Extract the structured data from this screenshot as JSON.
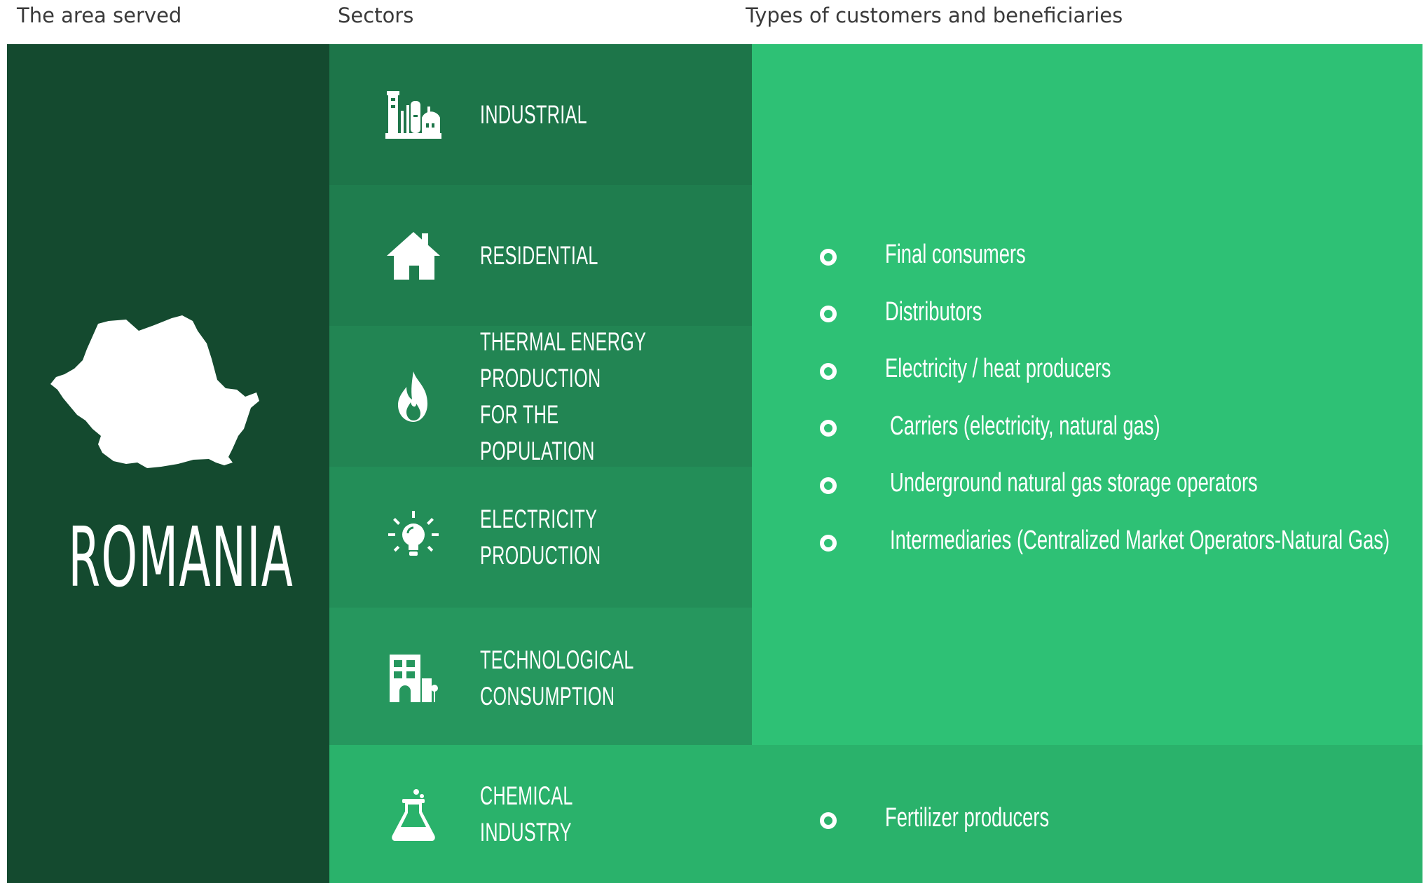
{
  "headers": {
    "area": "The area served",
    "sectors": "Sectors",
    "customers": "Types of customers and beneficiaries"
  },
  "area": {
    "country": "ROMANIA",
    "map_icon": "romania-map-icon"
  },
  "sectors": [
    {
      "label": "INDUSTRIAL",
      "icon": "factory-icon",
      "color": "#1d7549"
    },
    {
      "label": "RESIDENTIAL",
      "icon": "house-icon",
      "color": "#1f7d4e"
    },
    {
      "label": "THERMAL ENERGY PRODUCTION\nFOR THE POPULATION",
      "icon": "flame-icon",
      "color": "#228553"
    },
    {
      "label": "ELECTRICITY PRODUCTION",
      "icon": "lightbulb-icon",
      "color": "#238e58"
    },
    {
      "label": "TECHNOLOGICAL CONSUMPTION",
      "icon": "building-icon",
      "color": "#26975e"
    },
    {
      "label": "CHEMICAL INDUSTRY",
      "icon": "flask-icon",
      "color": "#2ab26b"
    }
  ],
  "customers": [
    "Final consumers",
    "Distributors",
    "Electricity / heat producers",
    "Carriers (electricity, natural gas)",
    "Underground natural gas storage operators",
    "Intermediaries (Centralized Market Operators-Natural Gas)"
  ],
  "chemical_customers": [
    "Fertilizer producers"
  ],
  "colors": {
    "area_bg": "#144a2f",
    "customers_bg": "#2ec175",
    "text": "#ffffff"
  }
}
